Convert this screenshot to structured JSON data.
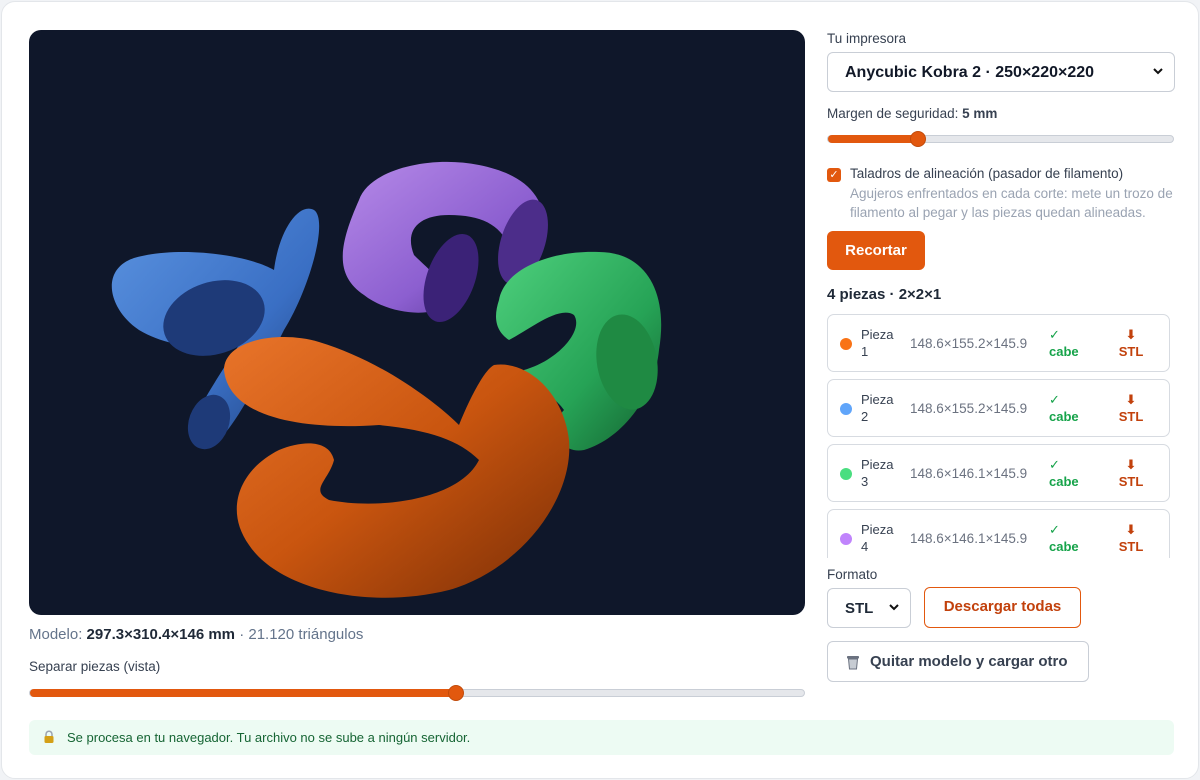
{
  "viewer": {
    "model_label": "Modelo:",
    "model_dims": "297.3×310.4×146 mm",
    "model_triangles": "· 21.120 triángulos",
    "separate_label": "Separar piezas (vista)",
    "separate_value": 0.55
  },
  "printer": {
    "label": "Tu impresora",
    "selected": "Anycubic Kobra 2 · 250×220×220"
  },
  "margin": {
    "label": "Margen de seguridad:",
    "value_text": "5 mm",
    "value": 0.26
  },
  "alignment": {
    "checked": true,
    "title": "Taladros de alineación (pasador de filamento)",
    "help": "Agujeros enfrentados en cada corte: mete un trozo de filamento al pegar y las piezas quedan alineadas."
  },
  "cut_button": "Recortar",
  "pieces_title": "4 piezas · 2×2×1",
  "pieces": [
    {
      "label": "Pieza 1",
      "color": "#f97316",
      "dims": "148.6×155.2×145.9",
      "fit_icon": "✓",
      "fit": "cabe",
      "dl_icon": "⬇",
      "dl": "STL"
    },
    {
      "label": "Pieza 2",
      "color": "#60a5fa",
      "dims": "148.6×155.2×145.9",
      "fit_icon": "✓",
      "fit": "cabe",
      "dl_icon": "⬇",
      "dl": "STL"
    },
    {
      "label": "Pieza 3",
      "color": "#4ade80",
      "dims": "148.6×146.1×145.9",
      "fit_icon": "✓",
      "fit": "cabe",
      "dl_icon": "⬇",
      "dl": "STL"
    },
    {
      "label": "Pieza 4",
      "color": "#c084fc",
      "dims": "148.6×146.1×145.9",
      "fit_icon": "✓",
      "fit": "cabe",
      "dl_icon": "⬇",
      "dl": "STL"
    }
  ],
  "format": {
    "label": "Formato",
    "selected": "STL"
  },
  "download_all": "Descargar todas",
  "remove_model": "Quitar modelo y cargar otro",
  "notice": "Se procesa en tu navegador. Tu archivo no se sube a ningún servidor.",
  "colors": {
    "accent": "#e2580e",
    "viewer_bg": "#0f172a",
    "success": "#16a34a"
  },
  "icons": [
    "chevron-down-icon",
    "checkmark-icon",
    "download-icon",
    "trash-icon",
    "lock-icon"
  ]
}
